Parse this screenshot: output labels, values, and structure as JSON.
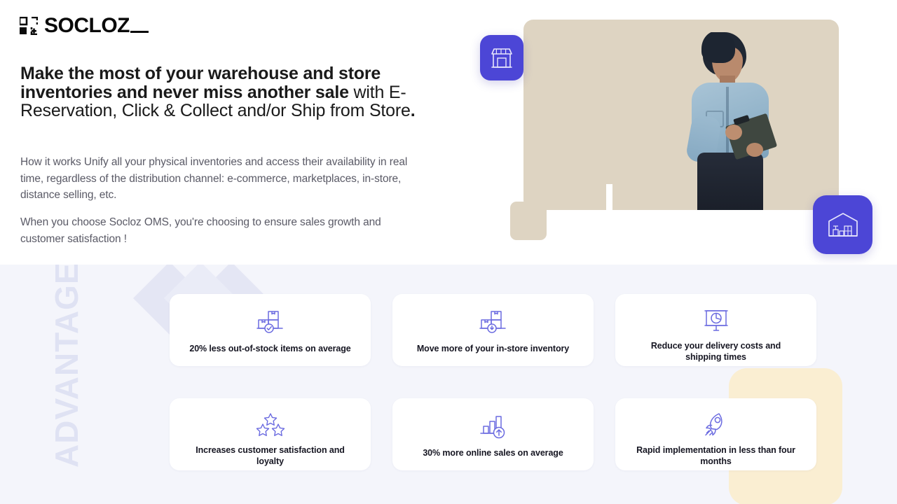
{
  "brand": {
    "logo_text": "SOCLOZ",
    "logo_mark_icon": "socloz-squares-mark-icon",
    "accent_purple": "#4c46d6",
    "icon_purple": "#6b6be0",
    "section_bg": "#f4f5fb",
    "cream_accent": "#faeed2",
    "chevron_color": "#e3e5f4"
  },
  "hero": {
    "headline": {
      "bold_part": "Make the most of your  warehouse and store inventories and never miss another sale",
      "regular_part": " with E-Reservation, Click & Collect and/or Ship from Store",
      "trailing_bold": "."
    },
    "paragraph_1": "How it works Unify all your physical inventories and access their availability in real time, regardless of the distribution channel: e-commerce, marketplaces, in-store, distance selling, etc.",
    "paragraph_2": "When you choose Socloz OMS, you're choosing to ensure sales growth and customer satisfaction !",
    "image_alt": "warehouse-worker-photo",
    "badges": [
      {
        "name": "storefront-badge",
        "icon": "storefront-icon"
      },
      {
        "name": "warehouse-badge",
        "icon": "warehouse-icon"
      }
    ]
  },
  "advantages": {
    "section_label": "ADVANTAGES",
    "cards": [
      {
        "icon": "boxes-check-icon",
        "label": "20% less out-of-stock items on average"
      },
      {
        "icon": "boxes-move-icon",
        "label": "Move more of your  in-store inventory"
      },
      {
        "icon": "presentation-pie-chart-icon",
        "label": "Reduce your delivery costs and shipping times"
      },
      {
        "icon": "three-stars-icon",
        "label": "Increases customer  satisfaction and loyalty"
      },
      {
        "icon": "bar-chart-up-icon",
        "label": "30% more online sales on  average"
      },
      {
        "icon": "rocket-icon",
        "label": "Rapid implementation in  less than four months"
      }
    ]
  }
}
